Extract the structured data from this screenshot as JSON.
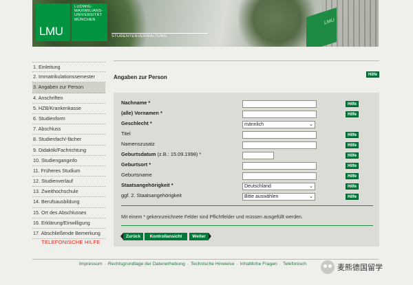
{
  "header": {
    "logo_text": "LMU",
    "university_lines": "LUDWIG-\nMAXIMILIANS-\nUNIVERSITÄT\nMÜNCHEN",
    "caption": "STUDENTENVERWALTUNG",
    "flag_text": "LMU"
  },
  "sidebar": {
    "items": [
      {
        "label": "1. Einleitung"
      },
      {
        "label": "2. Immatrikulationssemester"
      },
      {
        "label": "3. Angaben zur Person"
      },
      {
        "label": "4. Anschriften"
      },
      {
        "label": "5. HZB/Krankenkasse"
      },
      {
        "label": "6. Studienform"
      },
      {
        "label": "7. Abschluss"
      },
      {
        "label": "8. Studienfach/-fächer"
      },
      {
        "label": "9. Didaktik/Fachrichtung"
      },
      {
        "label": "10. Studienganginfo"
      },
      {
        "label": "11. Früheres Studium"
      },
      {
        "label": "12. Studienverlauf"
      },
      {
        "label": "13. Zweithochschule"
      },
      {
        "label": "14. Berufsausbildung"
      },
      {
        "label": "15. Ort des Abschlusses"
      },
      {
        "label": "16. Erklärung/Einwilligung"
      },
      {
        "label": "17. Abschließende Bemerkung"
      }
    ],
    "active_index": 2,
    "hotline": "TELEFONISCHE HILFE"
  },
  "main": {
    "title": "Angaben zur Person",
    "help_label": "Hilfe",
    "fields": {
      "nachname": {
        "label": "Nachname *",
        "value": ""
      },
      "vornamen": {
        "label": "(alle) Vornamen *",
        "value": ""
      },
      "geschlecht": {
        "label": "Geschlecht *",
        "value": "männlich"
      },
      "titel": {
        "label": "Titel",
        "value": ""
      },
      "namenszusatz": {
        "label": "Namenszusatz",
        "value": ""
      },
      "geburtsdatum": {
        "label": "Geburtsdatum",
        "hint": "(z.B.: 15.09.1998) *",
        "value": ""
      },
      "geburtsort": {
        "label": "Geburtsort *",
        "value": ""
      },
      "geburtsname": {
        "label": "Geburtsname",
        "value": ""
      },
      "staatsangehoerigkeit": {
        "label": "Staatsangehörigkeit *",
        "value": "Deutschland"
      },
      "staatsangehoerigkeit2": {
        "label": "ggf. 2. Staatsangehörigkeit",
        "value": "Bitte auswählen"
      }
    },
    "note": "Mit einem * gekennzeichnete Felder sind Pflichtfelder und müssen ausgefüllt werden.",
    "buttons": {
      "back": "Zurück",
      "check": "Kontrollansicht",
      "next": "Weiter"
    }
  },
  "footer": {
    "links": [
      "Impressum",
      "Rechtsgrundlage der Datenerhebung",
      "Technische Hinweise",
      "Inhaltliche Fragen",
      "Telefonisch"
    ],
    "separator": "·"
  },
  "watermark": {
    "text": "麦熊德国留学"
  },
  "colors": {
    "accent": "#00783a",
    "brand": "#009440",
    "hotline": "#e0251b",
    "panel": "#dcdcd6"
  }
}
